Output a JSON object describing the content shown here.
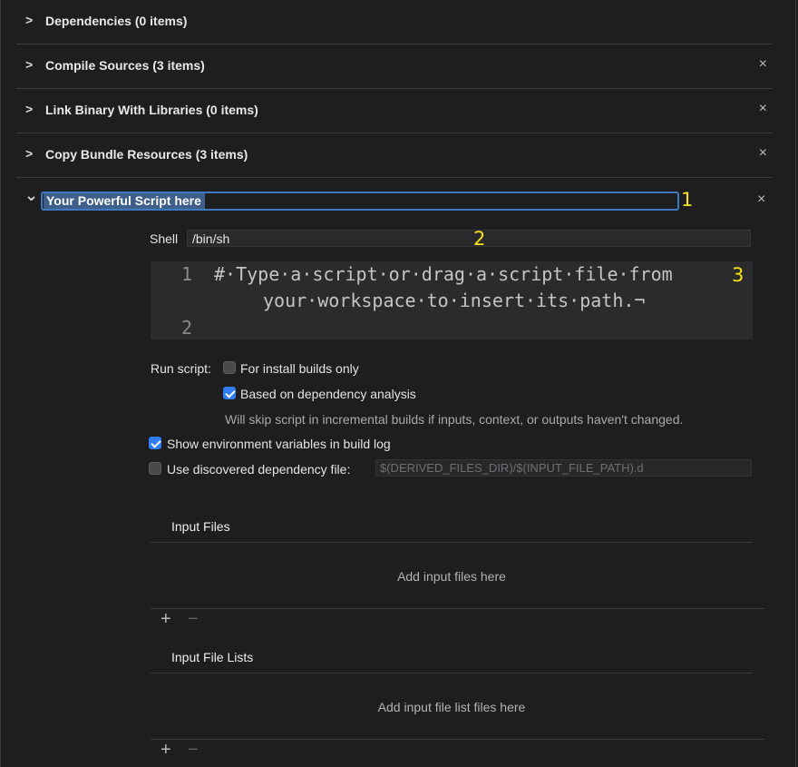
{
  "phases": [
    {
      "title": "Dependencies (0 items)",
      "chevron": ">",
      "removable": false
    },
    {
      "title": "Compile Sources (3 items)",
      "chevron": ">",
      "close": "×"
    },
    {
      "title": "Link Binary With Libraries (0 items)",
      "chevron": ">",
      "close": "×"
    },
    {
      "title": "Copy Bundle Resources (3 items)",
      "chevron": ">",
      "close": "×"
    }
  ],
  "script_phase": {
    "chevron": "⌄",
    "title": "Your Powerful Script here",
    "close": "×",
    "shell_label": "Shell",
    "shell_value": "/bin/sh",
    "editor": {
      "line1_number": "1",
      "line1_text": "# Type a script or drag a script file from",
      "line1_wrap": "your workspace to insert its path.¬",
      "line2_number": "2"
    },
    "run_script_label": "Run script:",
    "for_install_label": "For install builds only",
    "for_install_checked": false,
    "dependency_analysis_label": "Based on dependency analysis",
    "dependency_analysis_checked": true,
    "dependency_hint": "Will skip script in incremental builds if inputs, context, or outputs haven't changed.",
    "show_env_label": "Show environment variables in build log",
    "show_env_checked": true,
    "discovered_dep_label": "Use discovered dependency file:",
    "discovered_dep_checked": false,
    "discovered_dep_placeholder": "$(DERIVED_FILES_DIR)/$(INPUT_FILE_PATH).d"
  },
  "markers": {
    "one": "1",
    "two": "2",
    "three": "3"
  },
  "input_files": {
    "title": "Input Files",
    "placeholder": "Add input files here",
    "add": "+",
    "remove": "−"
  },
  "input_file_lists": {
    "title": "Input File Lists",
    "placeholder": "Add input file list files here",
    "add": "+",
    "remove": "−"
  },
  "colors": {
    "accent": "#2f7cf6",
    "marker": "#f7e11a",
    "background": "#1e1e20"
  }
}
